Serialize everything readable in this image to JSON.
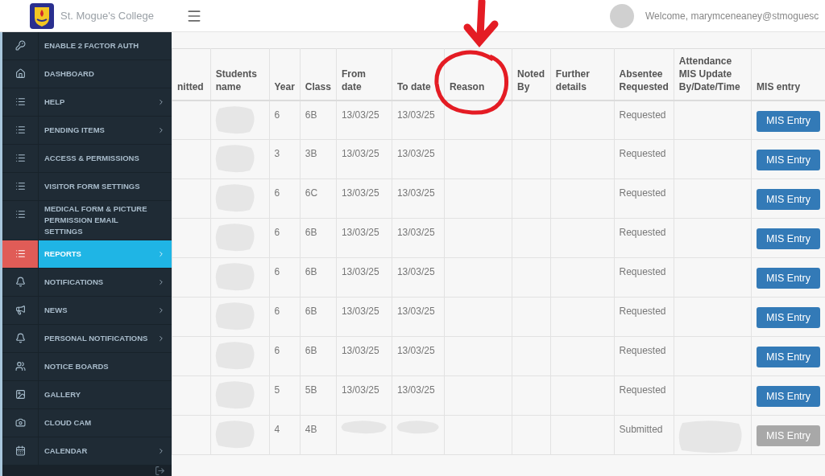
{
  "header": {
    "school_name": "St. Mogue's College",
    "welcome": "Welcome, marymceneaney@stmoguesc"
  },
  "sidebar": {
    "items": [
      {
        "label": "ENABLE 2 FACTOR AUTH",
        "selected": false,
        "has_submenu": false
      },
      {
        "label": "DASHBOARD",
        "selected": false,
        "has_submenu": false
      },
      {
        "label": "HELP",
        "selected": false,
        "has_submenu": true
      },
      {
        "label": "PENDING ITEMS",
        "selected": false,
        "has_submenu": true
      },
      {
        "label": "ACCESS & PERMISSIONS",
        "selected": false,
        "has_submenu": false
      },
      {
        "label": "VISITOR FORM SETTINGS",
        "selected": false,
        "has_submenu": false
      },
      {
        "label": "MEDICAL FORM & PICTURE PERMISSION EMAIL SETTINGS",
        "selected": false,
        "has_submenu": false
      },
      {
        "label": "REPORTS",
        "selected": true,
        "has_submenu": true
      },
      {
        "label": "NOTIFICATIONS",
        "selected": false,
        "has_submenu": true
      },
      {
        "label": "NEWS",
        "selected": false,
        "has_submenu": true
      },
      {
        "label": "PERSONAL NOTIFICATIONS",
        "selected": false,
        "has_submenu": true
      },
      {
        "label": "NOTICE BOARDS",
        "selected": false,
        "has_submenu": false
      },
      {
        "label": "GALLERY",
        "selected": false,
        "has_submenu": false
      },
      {
        "label": "CLOUD CAM",
        "selected": false,
        "has_submenu": false
      },
      {
        "label": "CALENDAR",
        "selected": false,
        "has_submenu": true
      }
    ]
  },
  "table": {
    "columns": [
      "nitted",
      "Students name",
      "Year",
      "Class",
      "From date",
      "To date",
      "Reason",
      "Noted By",
      "Further details",
      "Absentee Requested",
      "Attendance MIS Update By/Date/Time",
      "MIS entry"
    ],
    "rows": [
      {
        "kind": "requested",
        "year": "6",
        "class": "6B",
        "from_date": "13/03/25",
        "to_date": "13/03/25",
        "absentee": "Requested",
        "button": {
          "label": "MIS Entry",
          "disabled": false
        }
      },
      {
        "kind": "requested",
        "year": "3",
        "class": "3B",
        "from_date": "13/03/25",
        "to_date": "13/03/25",
        "absentee": "Requested",
        "button": {
          "label": "MIS Entry",
          "disabled": false
        }
      },
      {
        "kind": "requested",
        "year": "6",
        "class": "6C",
        "from_date": "13/03/25",
        "to_date": "13/03/25",
        "absentee": "Requested",
        "button": {
          "label": "MIS Entry",
          "disabled": false
        }
      },
      {
        "kind": "requested",
        "year": "6",
        "class": "6B",
        "from_date": "13/03/25",
        "to_date": "13/03/25",
        "absentee": "Requested",
        "button": {
          "label": "MIS Entry",
          "disabled": false
        }
      },
      {
        "kind": "requested",
        "year": "6",
        "class": "6B",
        "from_date": "13/03/25",
        "to_date": "13/03/25",
        "absentee": "Requested",
        "button": {
          "label": "MIS Entry",
          "disabled": false
        }
      },
      {
        "kind": "requested",
        "year": "6",
        "class": "6B",
        "from_date": "13/03/25",
        "to_date": "13/03/25",
        "absentee": "Requested",
        "button": {
          "label": "MIS Entry",
          "disabled": false
        }
      },
      {
        "kind": "requested",
        "year": "6",
        "class": "6B",
        "from_date": "13/03/25",
        "to_date": "13/03/25",
        "absentee": "Requested",
        "button": {
          "label": "MIS Entry",
          "disabled": false
        }
      },
      {
        "kind": "requested",
        "year": "5",
        "class": "5B",
        "from_date": "13/03/25",
        "to_date": "13/03/25",
        "absentee": "Requested",
        "button": {
          "label": "MIS Entry",
          "disabled": false
        }
      },
      {
        "kind": "submitted",
        "year": "4",
        "class": "4B",
        "absentee": "Submitted",
        "button": {
          "label": "MIS Entry",
          "disabled": true
        }
      }
    ]
  }
}
